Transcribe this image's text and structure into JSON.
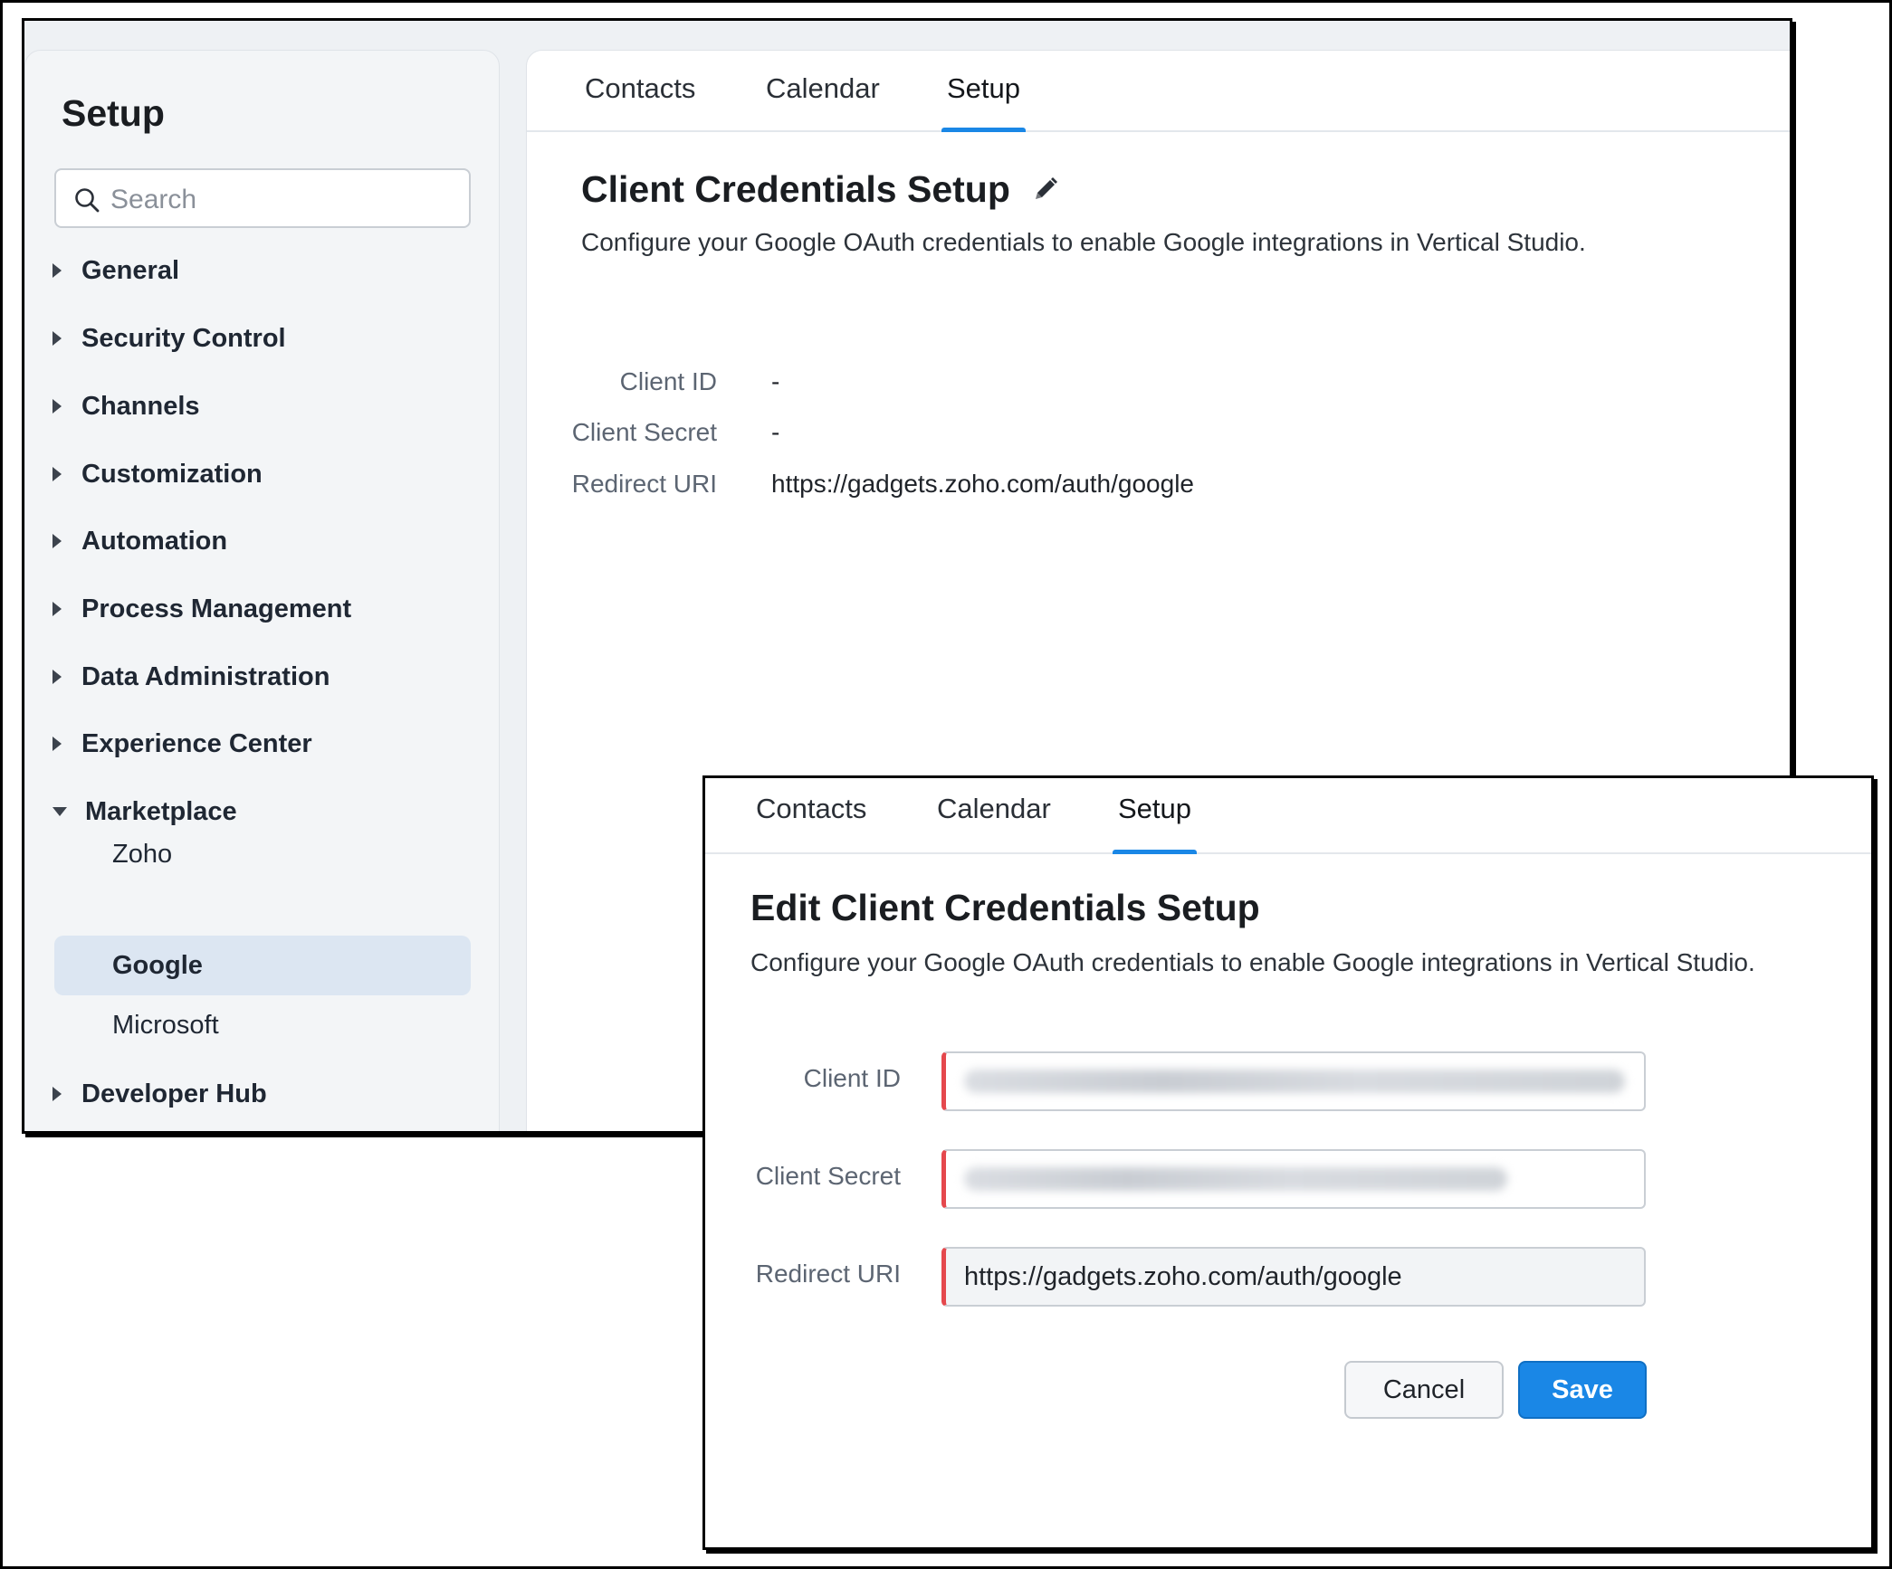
{
  "sidebar": {
    "title": "Setup",
    "search_placeholder": "Search",
    "items": [
      {
        "label": "General"
      },
      {
        "label": "Security Control"
      },
      {
        "label": "Channels"
      },
      {
        "label": "Customization"
      },
      {
        "label": "Automation"
      },
      {
        "label": "Process Management"
      },
      {
        "label": "Data Administration"
      },
      {
        "label": "Experience Center"
      },
      {
        "label": "Marketplace",
        "expanded": true
      },
      {
        "label": "Developer Hub"
      }
    ],
    "marketplace_subitems": [
      {
        "label": "Zoho"
      },
      {
        "label": "Google",
        "active": true
      },
      {
        "label": "Microsoft"
      }
    ]
  },
  "tabs": [
    {
      "label": "Contacts"
    },
    {
      "label": "Calendar"
    },
    {
      "label": "Setup",
      "active": true
    }
  ],
  "view": {
    "title": "Client Credentials Setup",
    "description": "Configure your Google OAuth credentials to enable Google integrations in Vertical Studio.",
    "fields": [
      {
        "label": "Client ID",
        "value": "-"
      },
      {
        "label": "Client Secret",
        "value": "-"
      },
      {
        "label": "Redirect URI",
        "value": "https://gadgets.zoho.com/auth/google"
      }
    ]
  },
  "edit": {
    "title": "Edit Client Credentials Setup",
    "description": "Configure your Google OAuth credentials to enable Google integrations in Vertical Studio.",
    "fields": [
      {
        "label": "Client ID",
        "value": ""
      },
      {
        "label": "Client Secret",
        "value": ""
      },
      {
        "label": "Redirect URI",
        "value": "https://gadgets.zoho.com/auth/google"
      }
    ],
    "cancel_label": "Cancel",
    "save_label": "Save"
  },
  "colors": {
    "accent": "#1a87e6",
    "required_marker": "#e5484d",
    "active_nav_bg": "#dce6f2"
  }
}
